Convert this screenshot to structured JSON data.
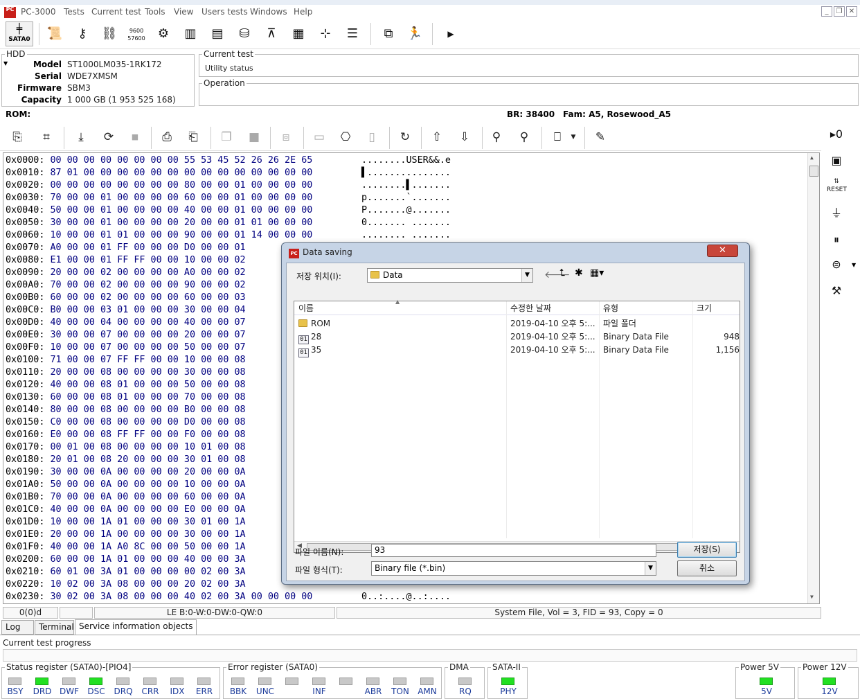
{
  "app": {
    "title": "PC-3000",
    "logo": "PC",
    "menu": [
      "Tests",
      "Current test",
      "Tools",
      "View",
      "Users tests",
      "Windows",
      "Help"
    ]
  },
  "toolbar": {
    "sata_label": "SATA0",
    "icons": [
      "document-icon",
      "key-icon",
      "network-icon",
      "baud-icon",
      "gear-icon",
      "chip-icon",
      "flash-icon",
      "disk-icon",
      "head-icon",
      "grid-icon",
      "tree-icon",
      "list-icon",
      "windows-icon",
      "run-icon",
      "play-icon"
    ],
    "baud_top": "9600",
    "baud_bottom": "57600"
  },
  "hdd": {
    "group_label": "HDD",
    "fields": [
      {
        "label": "Model",
        "value": "ST1000LM035-1RK172"
      },
      {
        "label": "Serial",
        "value": "WDE7XMSM"
      },
      {
        "label": "Firmware",
        "value": "SBM3"
      },
      {
        "label": "Capacity",
        "value": "1 000 GB (1 953 525 168)"
      }
    ]
  },
  "current_test": {
    "label": "Current test",
    "value": "Utility status"
  },
  "operation": {
    "label": "Operation",
    "value": ""
  },
  "rom_line": {
    "rom": "ROM:",
    "br": "BR: 38400",
    "fam": "Fam: A5, Rosewood_A5"
  },
  "hex": {
    "rows": [
      {
        "addr": "0x0000:",
        "bytes": "00 00 00 00 00 00 00 00 55 53 45 52 26 26 2E 65",
        "ascii": "........USER&&.e"
      },
      {
        "addr": "0x0010:",
        "bytes": "87 01 00 00 00 00 00 00 00 00 00 00 00 00 00 00",
        "ascii": "▌..............."
      },
      {
        "addr": "0x0020:",
        "bytes": "00 00 00 00 00 00 00 00 80 00 00 01 00 00 00 00",
        "ascii": "........▌......."
      },
      {
        "addr": "0x0030:",
        "bytes": "70 00 00 01 00 00 00 00 60 00 00 01 00 00 00 00",
        "ascii": "p.......`......."
      },
      {
        "addr": "0x0040:",
        "bytes": "50 00 00 01 00 00 00 00 40 00 00 01 00 00 00 00",
        "ascii": "P.......@......."
      },
      {
        "addr": "0x0050:",
        "bytes": "30 00 00 01 00 00 00 00 20 00 00 01 01 00 00 00",
        "ascii": "0....... ......."
      },
      {
        "addr": "0x0060:",
        "bytes": "10 00 00 01 01 00 00 00 90 00 00 01 14 00 00 00",
        "ascii": "........ ......."
      },
      {
        "addr": "0x0070:",
        "bytes": "A0 00 00 01 FF 00 00 00 D0 00 00 01",
        "ascii": ""
      },
      {
        "addr": "0x0080:",
        "bytes": "E1 00 00 01 FF FF 00 00 10 00 00 02",
        "ascii": ""
      },
      {
        "addr": "0x0090:",
        "bytes": "20 00 00 02 00 00 00 00 A0 00 00 02",
        "ascii": ""
      },
      {
        "addr": "0x00A0:",
        "bytes": "70 00 00 02 00 00 00 00 90 00 00 02",
        "ascii": ""
      },
      {
        "addr": "0x00B0:",
        "bytes": "60 00 00 02 00 00 00 00 60 00 00 03",
        "ascii": ""
      },
      {
        "addr": "0x00C0:",
        "bytes": "B0 00 00 03 01 00 00 00 30 00 00 04",
        "ascii": ""
      },
      {
        "addr": "0x00D0:",
        "bytes": "40 00 00 04 00 00 00 00 40 00 00 07",
        "ascii": ""
      },
      {
        "addr": "0x00E0:",
        "bytes": "30 00 00 07 00 00 00 00 20 00 00 07",
        "ascii": ""
      },
      {
        "addr": "0x00F0:",
        "bytes": "10 00 00 07 00 00 00 00 50 00 00 07",
        "ascii": ""
      },
      {
        "addr": "0x0100:",
        "bytes": "71 00 00 07 FF FF 00 00 10 00 00 08",
        "ascii": ""
      },
      {
        "addr": "0x0110:",
        "bytes": "20 00 00 08 00 00 00 00 30 00 00 08",
        "ascii": ""
      },
      {
        "addr": "0x0120:",
        "bytes": "40 00 00 08 01 00 00 00 50 00 00 08",
        "ascii": ""
      },
      {
        "addr": "0x0130:",
        "bytes": "60 00 00 08 01 00 00 00 70 00 00 08",
        "ascii": ""
      },
      {
        "addr": "0x0140:",
        "bytes": "80 00 00 08 00 00 00 00 B0 00 00 08",
        "ascii": ""
      },
      {
        "addr": "0x0150:",
        "bytes": "C0 00 00 08 00 00 00 00 D0 00 00 08",
        "ascii": ""
      },
      {
        "addr": "0x0160:",
        "bytes": "E0 00 00 08 FF FF 00 00 F0 00 00 08",
        "ascii": ""
      },
      {
        "addr": "0x0170:",
        "bytes": "00 01 00 08 00 00 00 00 10 01 00 08",
        "ascii": ""
      },
      {
        "addr": "0x0180:",
        "bytes": "20 01 00 08 20 00 00 00 30 01 00 08",
        "ascii": ""
      },
      {
        "addr": "0x0190:",
        "bytes": "30 00 00 0A 00 00 00 00 20 00 00 0A",
        "ascii": ""
      },
      {
        "addr": "0x01A0:",
        "bytes": "50 00 00 0A 00 00 00 00 10 00 00 0A",
        "ascii": ""
      },
      {
        "addr": "0x01B0:",
        "bytes": "70 00 00 0A 00 00 00 00 60 00 00 0A",
        "ascii": ""
      },
      {
        "addr": "0x01C0:",
        "bytes": "40 00 00 0A 00 00 00 00 E0 00 00 0A",
        "ascii": ""
      },
      {
        "addr": "0x01D0:",
        "bytes": "10 00 00 1A 01 00 00 00 30 01 00 1A",
        "ascii": ""
      },
      {
        "addr": "0x01E0:",
        "bytes": "20 00 00 1A 00 00 00 00 30 00 00 1A",
        "ascii": ""
      },
      {
        "addr": "0x01F0:",
        "bytes": "40 00 00 1A A0 8C 00 00 50 00 00 1A",
        "ascii": ""
      },
      {
        "addr": "0x0200:",
        "bytes": "60 00 00 1A 01 00 00 00 40 00 00 3A",
        "ascii": ""
      },
      {
        "addr": "0x0210:",
        "bytes": "60 01 00 3A 01 00 00 00 00 02 00 3A",
        "ascii": ""
      },
      {
        "addr": "0x0220:",
        "bytes": "10 02 00 3A 08 00 00 00 20 02 00 3A",
        "ascii": ""
      },
      {
        "addr": "0x0230:",
        "bytes": "30 02 00 3A 08 00 00 00 40 02 00 3A 00 00 00 00",
        "ascii": "0..:....@..:...."
      }
    ]
  },
  "status_bar": {
    "pos": "0(0)d",
    "field2": "",
    "le": "LE B:0-W:0-DW:0-QW:0",
    "info": "System File, Vol = 3, FID = 93, Copy = 0"
  },
  "tabs": [
    "Log",
    "Terminal",
    "Service information objects"
  ],
  "progress_label": "Current test progress",
  "registers": {
    "status": {
      "title": "Status register (SATA0)-[PIO4]",
      "leds": [
        {
          "label": "BSY",
          "on": false
        },
        {
          "label": "DRD",
          "on": true
        },
        {
          "label": "DWF",
          "on": false
        },
        {
          "label": "DSC",
          "on": true
        },
        {
          "label": "DRQ",
          "on": false
        },
        {
          "label": "CRR",
          "on": false
        },
        {
          "label": "IDX",
          "on": false
        },
        {
          "label": "ERR",
          "on": false
        }
      ]
    },
    "error": {
      "title": "Error register (SATA0)",
      "leds": [
        {
          "label": "BBK",
          "on": false
        },
        {
          "label": "UNC",
          "on": false
        },
        {
          "label": "",
          "on": false
        },
        {
          "label": "INF",
          "on": false
        },
        {
          "label": "",
          "on": false
        },
        {
          "label": "ABR",
          "on": false
        },
        {
          "label": "TON",
          "on": false
        },
        {
          "label": "AMN",
          "on": false
        }
      ]
    },
    "dma": {
      "title": "DMA",
      "leds": [
        {
          "label": "RQ",
          "on": false
        }
      ]
    },
    "sata2": {
      "title": "SATA-II",
      "leds": [
        {
          "label": "PHY",
          "on": true
        }
      ]
    },
    "power5": {
      "title": "Power 5V",
      "leds": [
        {
          "label": "5V",
          "on": true
        }
      ]
    },
    "power12": {
      "title": "Power 12V",
      "leds": [
        {
          "label": "12V",
          "on": true
        }
      ]
    }
  },
  "dialog": {
    "title": "Data saving",
    "close": "✕",
    "save_in_label": "저장 위치(I):",
    "save_in_value": "Data",
    "columns": [
      "이름",
      "수정한 날짜",
      "유형",
      "크기"
    ],
    "files": [
      {
        "name": "ROM",
        "date": "2019-04-10 오후 5:...",
        "type": "파일 폴더",
        "size": "",
        "kind": "folder"
      },
      {
        "name": "28",
        "date": "2019-04-10 오후 5:...",
        "type": "Binary Data File",
        "size": "948",
        "kind": "bin"
      },
      {
        "name": "35",
        "date": "2019-04-10 오후 5:...",
        "type": "Binary Data File",
        "size": "1,156",
        "kind": "bin"
      }
    ],
    "filename_label": "파일 이름(N):",
    "filename_value": "93",
    "filetype_label": "파일 형식(T):",
    "filetype_value": "Binary file (*.bin)",
    "save_button": "저장(S)",
    "cancel_button": "취소"
  },
  "colors": {
    "led_on": "#22e022",
    "led_off": "#c8c8c8",
    "hex_bytes": "#000080",
    "dialog_frame": "#c6d4e6",
    "close": "#c8463a"
  }
}
